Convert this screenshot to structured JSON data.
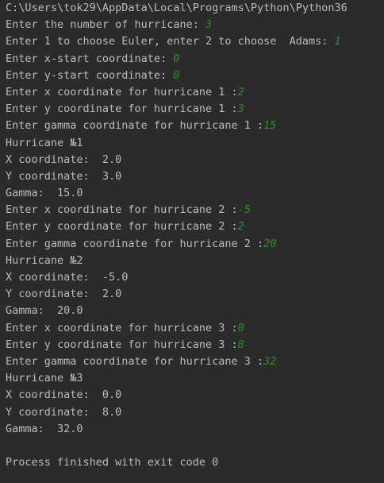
{
  "console": {
    "lines": [
      {
        "prompt": "C:\\Users\\tok29\\AppData\\Local\\Programs\\Python\\Python36",
        "input": ""
      },
      {
        "prompt": "Enter the number of hurricane: ",
        "input": "3"
      },
      {
        "prompt": "Enter 1 to choose Euler, enter 2 to choose  Adams: ",
        "input": "1"
      },
      {
        "prompt": "Enter x-start coordinate: ",
        "input": "0"
      },
      {
        "prompt": "Enter y-start coordinate: ",
        "input": "0"
      },
      {
        "prompt": "Enter x coordinate for hurricane 1 :",
        "input": "2"
      },
      {
        "prompt": "Enter y coordinate for hurricane 1 :",
        "input": "3"
      },
      {
        "prompt": "Enter gamma coordinate for hurricane 1 :",
        "input": "15"
      },
      {
        "prompt": "Hurricane №1",
        "input": ""
      },
      {
        "prompt": "X coordinate:  2.0",
        "input": ""
      },
      {
        "prompt": "Y coordinate:  3.0",
        "input": ""
      },
      {
        "prompt": "Gamma:  15.0",
        "input": ""
      },
      {
        "prompt": "Enter x coordinate for hurricane 2 :",
        "input": "-5"
      },
      {
        "prompt": "Enter y coordinate for hurricane 2 :",
        "input": "2"
      },
      {
        "prompt": "Enter gamma coordinate for hurricane 2 :",
        "input": "20"
      },
      {
        "prompt": "Hurricane №2",
        "input": ""
      },
      {
        "prompt": "X coordinate:  -5.0",
        "input": ""
      },
      {
        "prompt": "Y coordinate:  2.0",
        "input": ""
      },
      {
        "prompt": "Gamma:  20.0",
        "input": ""
      },
      {
        "prompt": "Enter x coordinate for hurricane 3 :",
        "input": "0"
      },
      {
        "prompt": "Enter y coordinate for hurricane 3 :",
        "input": "8"
      },
      {
        "prompt": "Enter gamma coordinate for hurricane 3 :",
        "input": "32"
      },
      {
        "prompt": "Hurricane №3",
        "input": ""
      },
      {
        "prompt": "X coordinate:  0.0",
        "input": ""
      },
      {
        "prompt": "Y coordinate:  8.0",
        "input": ""
      },
      {
        "prompt": "Gamma:  32.0",
        "input": ""
      },
      {
        "prompt": "",
        "input": ""
      },
      {
        "prompt": "Process finished with exit code 0",
        "input": ""
      }
    ]
  },
  "colors": {
    "background": "#2b2b2b",
    "output_text": "#bbbbbb",
    "user_input": "#2e8b2e"
  }
}
